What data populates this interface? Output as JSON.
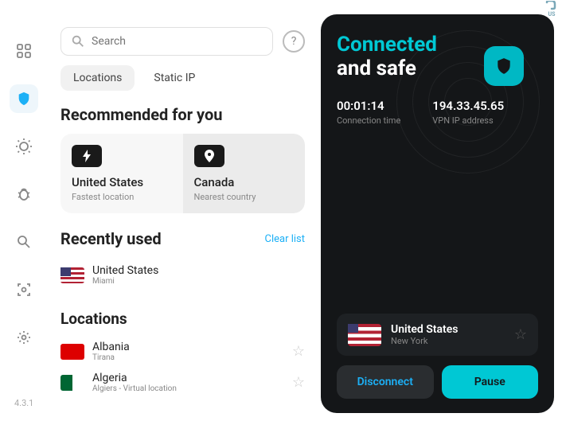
{
  "version": "4.3.1",
  "search": {
    "placeholder": "Search"
  },
  "tabs": {
    "locations": "Locations",
    "static_ip": "Static IP"
  },
  "recommended": {
    "title": "Recommended for you",
    "cards": [
      {
        "name": "United States",
        "sub": "Fastest location"
      },
      {
        "name": "Canada",
        "sub": "Nearest country"
      }
    ]
  },
  "recent": {
    "title": "Recently used",
    "clear": "Clear list",
    "items": [
      {
        "name": "United States",
        "sub": "Miami"
      }
    ]
  },
  "locations": {
    "title": "Locations",
    "items": [
      {
        "name": "Albania",
        "sub": "Tirana"
      },
      {
        "name": "Algeria",
        "sub": "Algiers - Virtual location"
      }
    ]
  },
  "status": {
    "line1": "Connected",
    "line2": "and safe",
    "time_value": "00:01:14",
    "time_label": "Connection time",
    "ip_value": "194.33.45.65",
    "ip_label": "VPN IP address"
  },
  "connection": {
    "country": "United States",
    "city": "New York"
  },
  "buttons": {
    "disconnect": "Disconnect",
    "pause": "Pause"
  },
  "corner_badge": "US"
}
